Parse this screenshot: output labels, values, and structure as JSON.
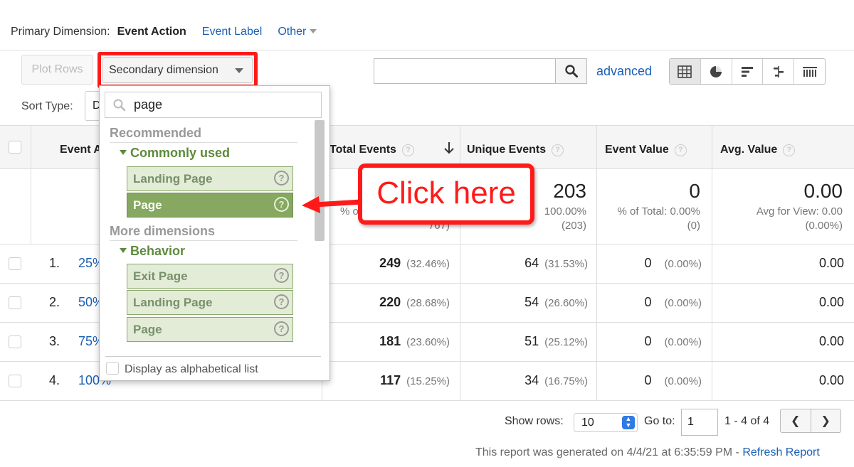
{
  "primary_dimension": {
    "label": "Primary Dimension:",
    "active": "Event Action",
    "options": [
      "Event Label",
      "Other"
    ]
  },
  "toolbar": {
    "plot_rows": "Plot Rows",
    "secondary_dimension": "Secondary dimension",
    "search_value": "",
    "advanced": "advanced",
    "sort_type_label": "Sort Type:",
    "sort_type_value": "D"
  },
  "table": {
    "columns": [
      "Event A",
      "Total Events",
      "Unique Events",
      "Event Value",
      "Avg. Value"
    ],
    "summary": {
      "total_events_pct_fragment": "% o",
      "total_events_count_fragment": "767)",
      "unique_events": "203",
      "unique_events_pct": "100.00%",
      "unique_events_count": "(203)",
      "event_value": "0",
      "event_value_pct": "% of Total: 0.00%",
      "event_value_count": "(0)",
      "avg_value": "0.00",
      "avg_value_sub": "Avg for View: 0.00",
      "avg_value_pct": "(0.00%)"
    },
    "rows": [
      {
        "num": "1.",
        "action": "25%",
        "total": "249",
        "total_pct": "(32.46%)",
        "unique": "64",
        "unique_pct": "(31.53%)",
        "value": "0",
        "value_pct": "(0.00%)",
        "avg": "0.00"
      },
      {
        "num": "2.",
        "action": "50%",
        "total": "220",
        "total_pct": "(28.68%)",
        "unique": "54",
        "unique_pct": "(26.60%)",
        "value": "0",
        "value_pct": "(0.00%)",
        "avg": "0.00"
      },
      {
        "num": "3.",
        "action": "75%",
        "total": "181",
        "total_pct": "(23.60%)",
        "unique": "51",
        "unique_pct": "(25.12%)",
        "value": "0",
        "value_pct": "(0.00%)",
        "avg": "0.00"
      },
      {
        "num": "4.",
        "action": "100%",
        "total": "117",
        "total_pct": "(15.25%)",
        "unique": "34",
        "unique_pct": "(16.75%)",
        "value": "0",
        "value_pct": "(0.00%)",
        "avg": "0.00"
      }
    ]
  },
  "dropdown": {
    "search_value": "page",
    "recommended": "Recommended",
    "commonly_used": "Commonly used",
    "commonly_used_items": [
      "Landing Page",
      "Page"
    ],
    "more_dimensions": "More dimensions",
    "behavior": "Behavior",
    "behavior_items": [
      "Exit Page",
      "Landing Page",
      "Page"
    ],
    "alphabetical": "Display as alphabetical list"
  },
  "callout": "Click here",
  "pagination": {
    "show_rows_label": "Show rows:",
    "show_rows_value": "10",
    "goto_label": "Go to:",
    "goto_value": "1",
    "range": "1 - 4 of 4"
  },
  "footer": {
    "generated": "This report was generated on 4/4/21 at 6:35:59 PM - ",
    "refresh": "Refresh Report"
  },
  "colors": {
    "highlight_red": "#ff1a1a",
    "link_blue": "#1a5fb4",
    "dimension_green": "#86a861"
  }
}
